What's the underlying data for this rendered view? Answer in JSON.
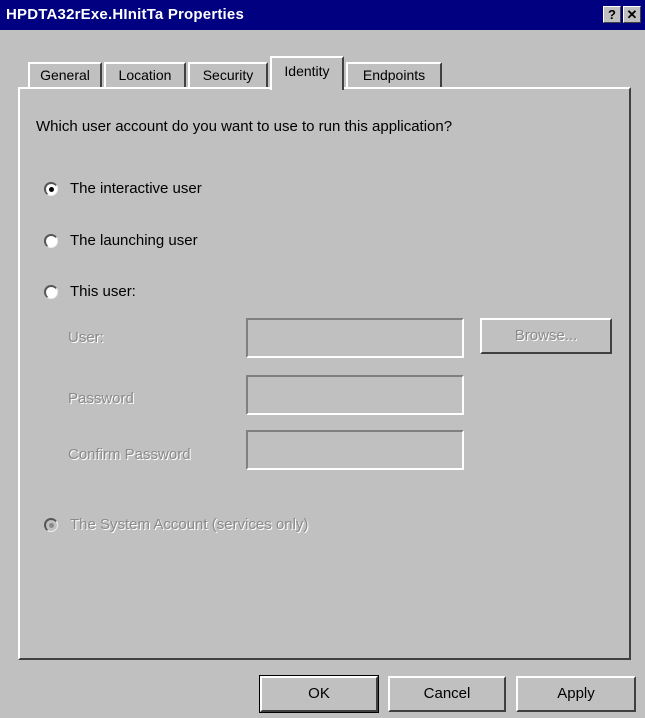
{
  "window": {
    "title": "HPDTA32rExe.HInitTa Properties",
    "help_label": "?",
    "close_label": "✕"
  },
  "tabs": [
    {
      "label": "General",
      "active": false
    },
    {
      "label": "Location",
      "active": false
    },
    {
      "label": "Security",
      "active": false
    },
    {
      "label": "Identity",
      "active": true
    },
    {
      "label": "Endpoints",
      "active": false
    }
  ],
  "identity": {
    "question": "Which user account do you want to use to run this application?",
    "options": [
      {
        "label": "The interactive user",
        "selected": true,
        "enabled": true
      },
      {
        "label": "The launching user",
        "selected": false,
        "enabled": true
      },
      {
        "label": "This user:",
        "selected": false,
        "enabled": true
      },
      {
        "label": "The System Account (services only)",
        "selected": true,
        "enabled": false
      }
    ],
    "fields": {
      "user_label": "User:",
      "user_value": "",
      "password_label": "Password",
      "password_value": "",
      "confirm_label": "Confirm Password",
      "confirm_value": "",
      "browse_label": "Browse..."
    }
  },
  "footer": {
    "ok_label": "OK",
    "cancel_label": "Cancel",
    "apply_label": "Apply"
  },
  "colors": {
    "titlebar": "#000080",
    "face": "#c0c0c0",
    "disabled_text": "#8a8a8a"
  }
}
